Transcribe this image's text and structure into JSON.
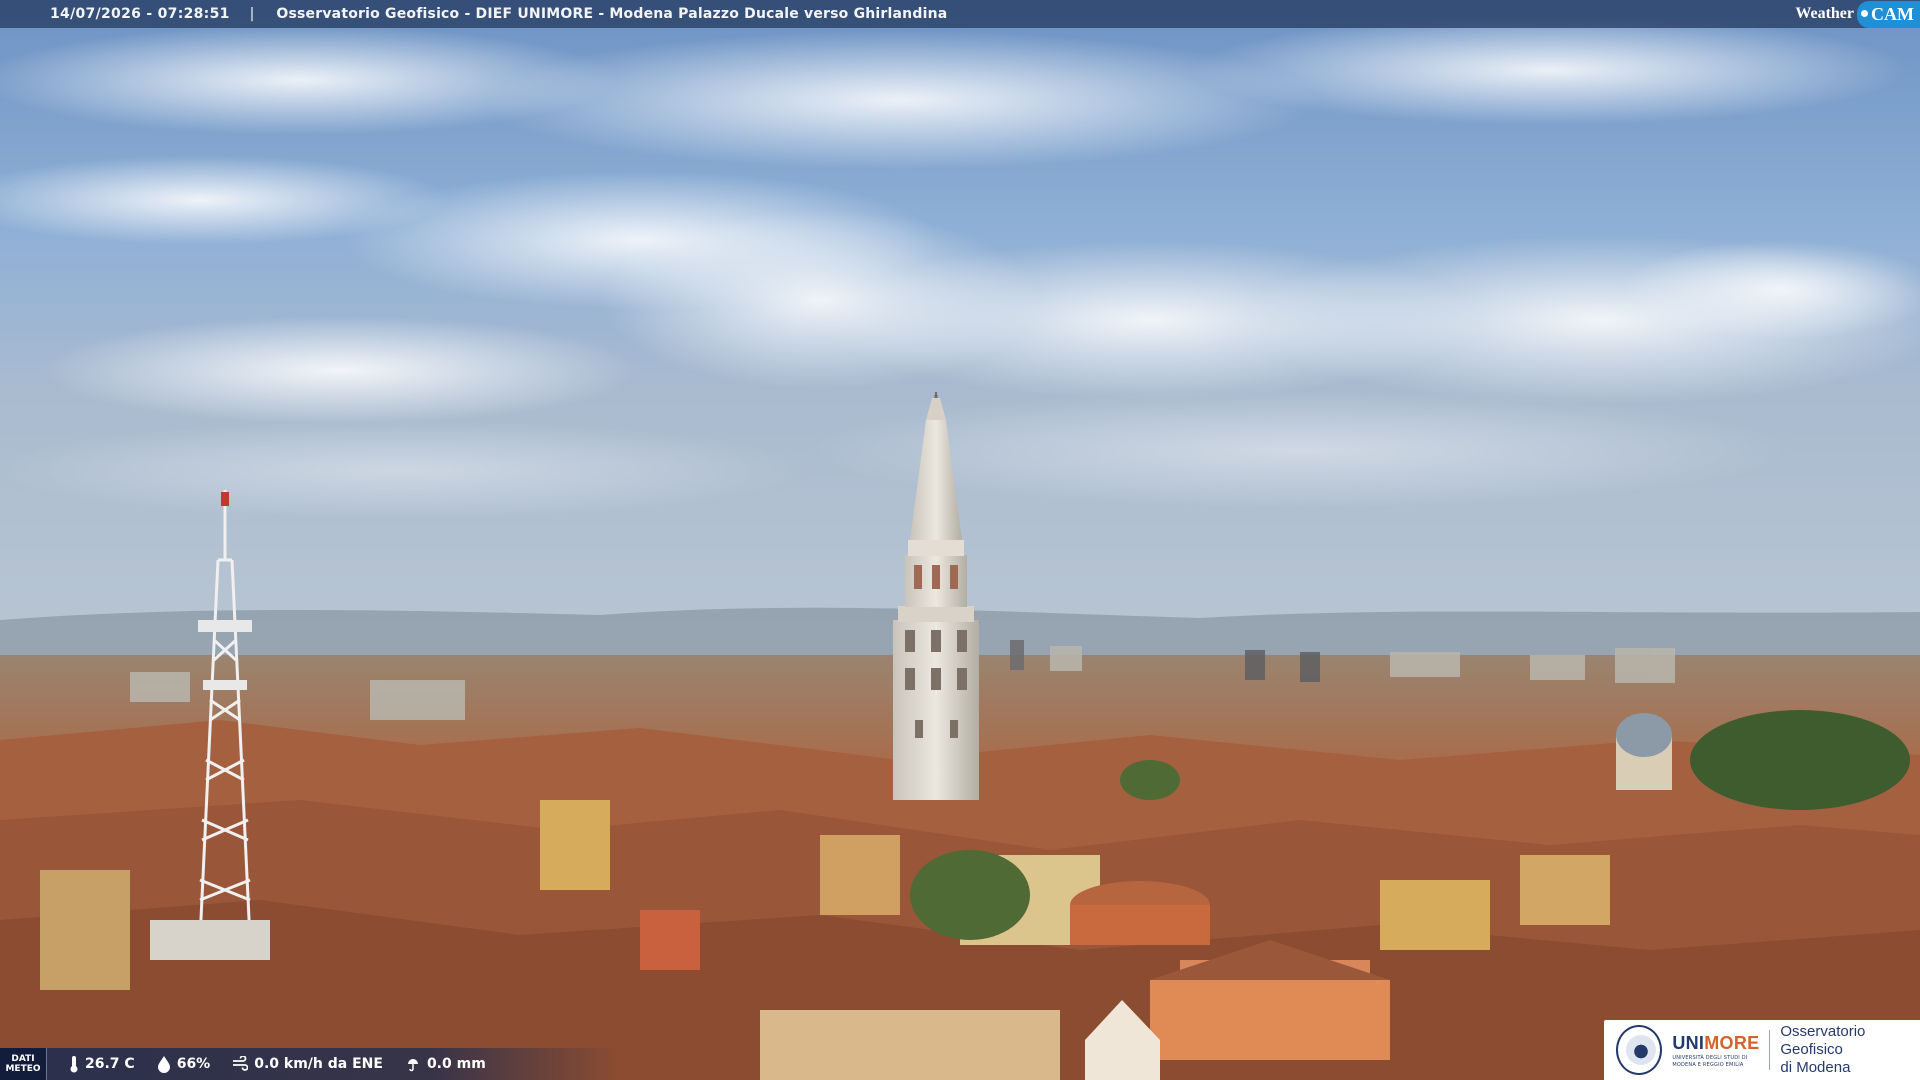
{
  "header": {
    "timestamp": "14/07/2026 - 07:28:51",
    "separator": "|",
    "title": "Osservatorio Geofisico - DIEF UNIMORE - Modena Palazzo Ducale verso Ghirlandina"
  },
  "brand": {
    "weather_label": "Weather",
    "cam_label": "CAM",
    "accent": "#1f8fd6"
  },
  "meteo": {
    "label_line1": "DATI",
    "label_line2": "METEO",
    "temperature": "26.7 C",
    "humidity": "66%",
    "wind": "0.0 km/h da ENE",
    "rain": "0.0 mm"
  },
  "logo": {
    "uni_prefix": "UNI",
    "uni_suffix": "MORE",
    "uni_line1": "UNIVERSITÀ DEGLI STUDI DI",
    "uni_line2": "MODENA E REGGIO EMILIA",
    "obs_line1": "Osservatorio Geofisico",
    "obs_line2": "di Modena",
    "brand_color": "#233a6b"
  },
  "icons": [
    "thermometer-icon",
    "humidity-drop-icon",
    "wind-icon",
    "rain-icon",
    "university-seal-icon"
  ]
}
